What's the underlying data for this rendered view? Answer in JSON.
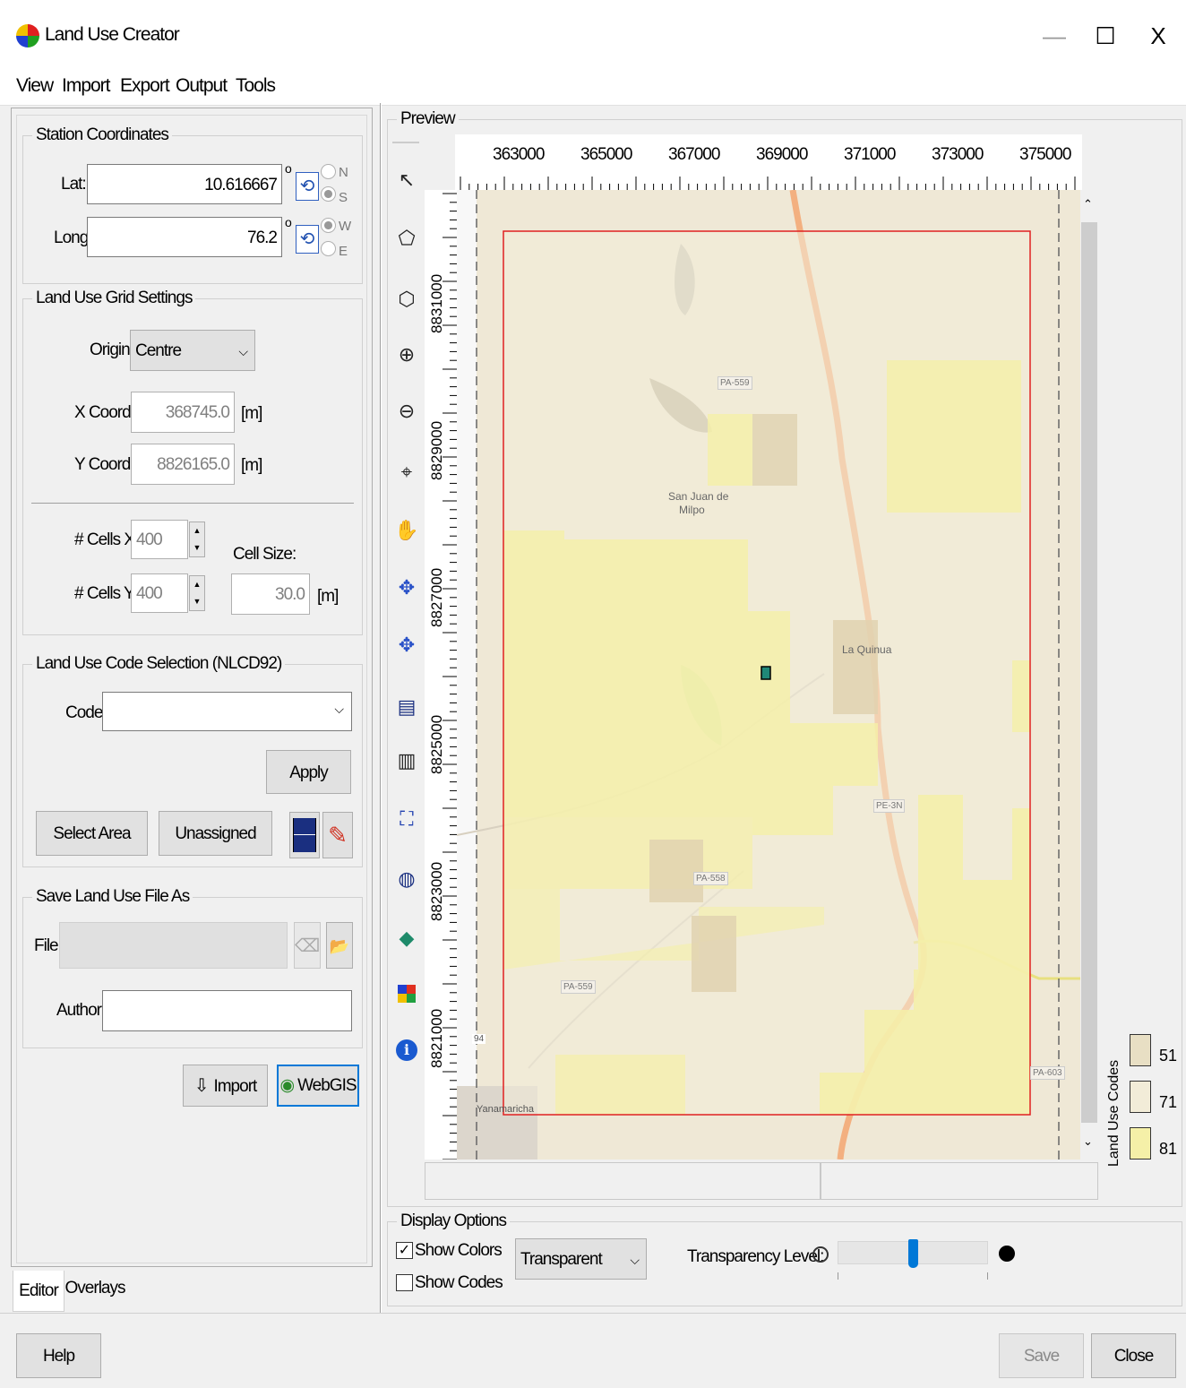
{
  "window": {
    "title": "Land Use Creator",
    "min_glyph": "—",
    "max_glyph": "☐",
    "close_glyph": "X"
  },
  "menu": [
    "View",
    "Import",
    "Export",
    "Output",
    "Tools"
  ],
  "station": {
    "legend": "Station Coordinates",
    "lat_label": "Lat:",
    "lat_value": "10.616667",
    "long_label": "Long:",
    "long_value": "76.2",
    "degree": "o",
    "hemi": [
      "N",
      "S",
      "W",
      "E"
    ]
  },
  "grid": {
    "legend": "Land Use Grid Settings",
    "origin_label": "Origin:",
    "origin_value": "Centre",
    "x_label": "X Coord.:",
    "x_value": "368745.0",
    "y_label": "Y Coord.:",
    "y_value": "8826165.0",
    "unit": "[m]",
    "cellsx_label": "# Cells X:",
    "cellsx_value": "400",
    "cellsy_label": "# Cells Y:",
    "cellsy_value": "400",
    "cellsize_label": "Cell Size:",
    "cellsize_value": "30.0"
  },
  "landuse": {
    "legend": "Land Use Code Selection (NLCD92)",
    "code_label": "Code:",
    "code_value": "",
    "apply": "Apply",
    "select_area": "Select Area",
    "unassigned": "Unassigned"
  },
  "save": {
    "legend": "Save Land Use File As",
    "file_label": "File:",
    "file_value": "",
    "author_label": "Author:",
    "author_value": ""
  },
  "actions": {
    "import": "Import",
    "webgis": "WebGIS"
  },
  "tabs": [
    "Editor",
    "Overlays"
  ],
  "preview": {
    "legend": "Preview",
    "x_ticks": [
      "363000",
      "365000",
      "367000",
      "369000",
      "371000",
      "373000",
      "375000"
    ],
    "y_ticks": [
      "8831000",
      "8829000",
      "8827000",
      "8825000",
      "8823000",
      "8821000"
    ],
    "map_labels": {
      "road1": "PA-559",
      "town1": "San Juan de",
      "town1b": "Milpo",
      "town2": "La Quinua",
      "road2": "PE-3N",
      "road3": "PA-558",
      "road4": "PA-559",
      "road5": "PA-603",
      "town3": "Yanamaricha",
      "road6": "94"
    },
    "legend_title": "Land Use Codes",
    "codes": [
      {
        "code": "51",
        "color": "#e8dfc4"
      },
      {
        "code": "71",
        "color": "#f2ecd8"
      },
      {
        "code": "81",
        "color": "#f5f0a8"
      }
    ],
    "grid_color": "#ff0000"
  },
  "display": {
    "legend": "Display Options",
    "show_colors": "Show Colors",
    "show_codes": "Show Codes",
    "mode": "Transparent",
    "transparency_label": "Transparency Level:",
    "transparency_level": 0.5
  },
  "footer": {
    "help": "Help",
    "save": "Save",
    "close": "Close"
  }
}
